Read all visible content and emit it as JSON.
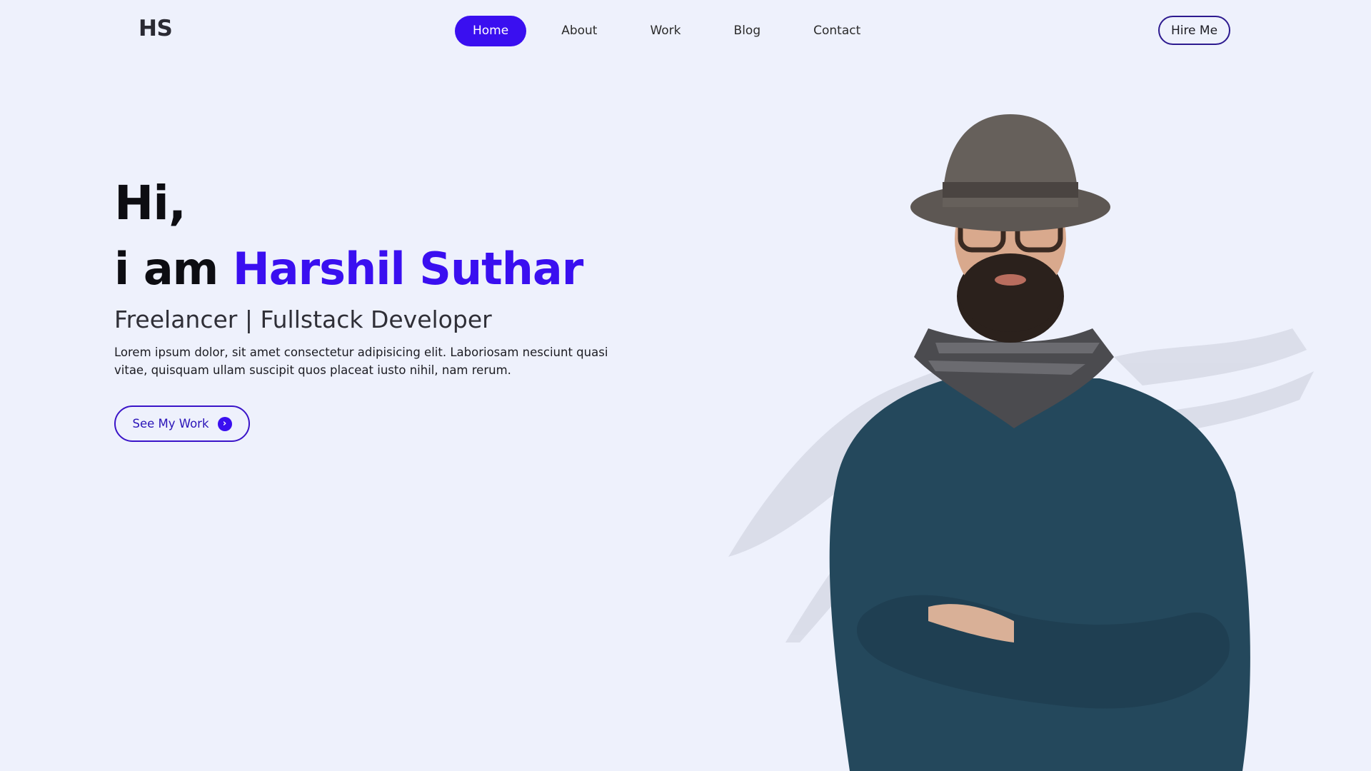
{
  "brand": {
    "logo": "HS"
  },
  "nav": {
    "items": [
      {
        "label": "Home",
        "active": true
      },
      {
        "label": "About"
      },
      {
        "label": "Work"
      },
      {
        "label": "Blog"
      },
      {
        "label": "Contact"
      }
    ],
    "hire_label": "Hire Me"
  },
  "hero": {
    "greeting": "Hi,",
    "intro": "i am",
    "name": "Harshil Suthar",
    "role": "Freelancer | Fullstack Developer",
    "description": "Lorem ipsum dolor, sit amet consectetur adipisicing elit. Laboriosam nesciunt quasi vitae, quisquam ullam suscipit quos placeat iusto nihil, nam rerum.",
    "cta_label": "See My Work",
    "cta_icon": "chevron-right-circle-icon"
  },
  "colors": {
    "background": "#eef1fc",
    "accent": "#3a0ff0",
    "text": "#0d0d12"
  }
}
